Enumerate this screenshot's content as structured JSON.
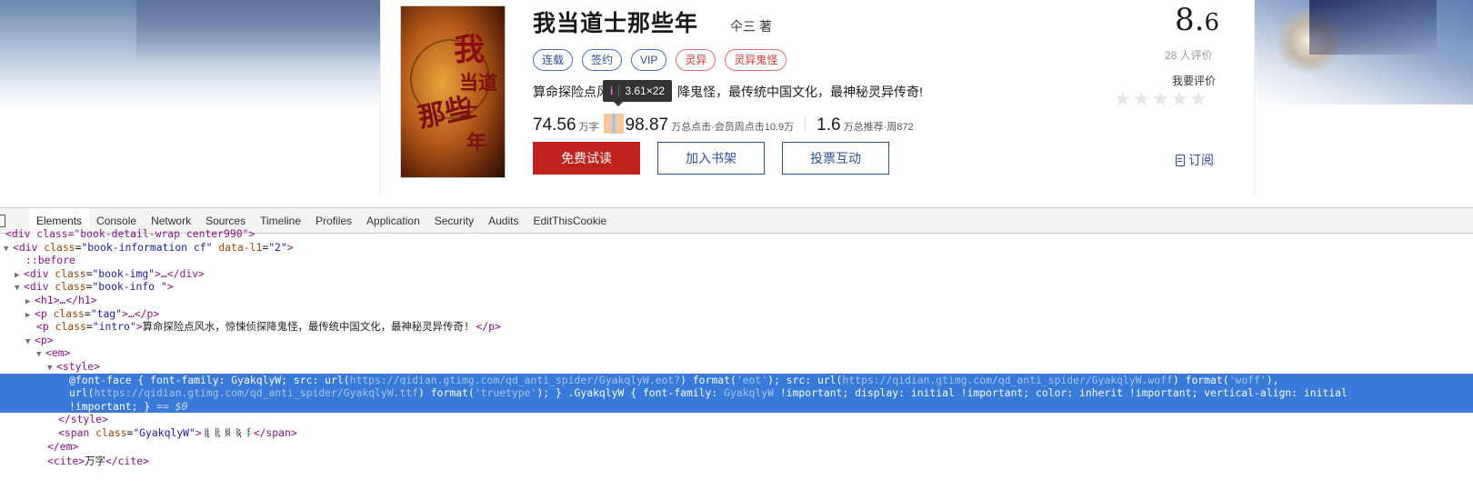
{
  "book": {
    "title": "我当道士那些年",
    "author": "仐三 著",
    "cover_texts": [
      "我",
      "当道士",
      "那些",
      "年"
    ],
    "tags": [
      {
        "label": "连载",
        "style": "blue"
      },
      {
        "label": "签约",
        "style": "blue"
      },
      {
        "label": "VIP",
        "style": "blue"
      },
      {
        "label": "灵异",
        "style": "red"
      },
      {
        "label": "灵异鬼怪",
        "style": "red"
      }
    ],
    "intro": "算命探险点风水，惊悚侦探降鬼怪，最传统中国文化，最神秘灵异传奇!",
    "intro_visible_left": "算命探险点风",
    "intro_visible_right": "降鬼怪，最传统中国文化，最神秘灵异传奇!",
    "stats": {
      "words": "74.56",
      "words_unit": "万字",
      "clicks": "98.87",
      "clicks_unit": "万总点击·会员周点击10.9万",
      "recommend": "1.6",
      "recommend_unit": "万总推荐·周872"
    },
    "buttons": {
      "read": "免费试读",
      "shelf": "加入书架",
      "vote": "投票互动"
    },
    "rating": {
      "score_int": "8.",
      "score_dec": "6",
      "count": "28 人评价",
      "rate_label": "我要评价",
      "stars_value": 0
    },
    "subscribe": "订阅"
  },
  "tooltip": {
    "icon": "i",
    "text": "3.61×22"
  },
  "devtools": {
    "tabs": [
      "Elements",
      "Console",
      "Network",
      "Sources",
      "Timeline",
      "Profiles",
      "Application",
      "Security",
      "Audits",
      "EditThisCookie"
    ],
    "active_tab": "Elements",
    "lines": {
      "l0": "<div class=\"book-detail-wrap center990\">",
      "l1_tag": "<div",
      "l1_attr": "class",
      "l1_val": "\"book-information cf\"",
      "l1_attr2": "data-l1",
      "l1_val2": "\"2\"",
      "l2": "::before",
      "l3_attr": "class",
      "l3_val": "\"book-img\"",
      "l4_val": "\"book-info \"",
      "l5": "<h1>…</h1>",
      "l6_val": "\"tag\"",
      "l7_val": "\"intro\"",
      "l7_text": "算命探险点风水，惊悚侦探降鬼怪，最传统中国文化，最神秘灵异传奇! ",
      "l8": "<p>",
      "l9": "<em>",
      "l10": "<style>",
      "css1a": "@font-face { font-family: GyakqlyW; src: url(",
      "css1b": "https://qidian.gtimg.com/qd_anti_spider/GyakqlyW.eot?",
      "css1c": ") format(",
      "css1d": "'eot'",
      "css1e": "); src: url(",
      "css1f": "https://qidian.gtimg.com/qd_anti_spider/GyakqlyW.woff",
      "css1g": ") format(",
      "css1h": "'woff'",
      "css1i": "),",
      "css2a": "url(",
      "css2b": "https://qidian.gtimg.com/qd_anti_spider/GyakqlyW.ttf",
      "css2c": ") format(",
      "css2d": "'truetype'",
      "css2e": "); } .GyakqlyW { font-family: ",
      "css2f": "GyakqlyW",
      "css2g": " !important;     display: initial !important; color: inherit !important; vertical-align: initial",
      "css3a": "!important; }",
      "css3b": " == $0",
      "l12": "</style>",
      "l13_val": "\"GyakqlyW\"",
      "l13_text": "𘢀𘢁𘢂𘢃𘢄",
      "l14": "</em>",
      "l15_text": "万字"
    }
  }
}
